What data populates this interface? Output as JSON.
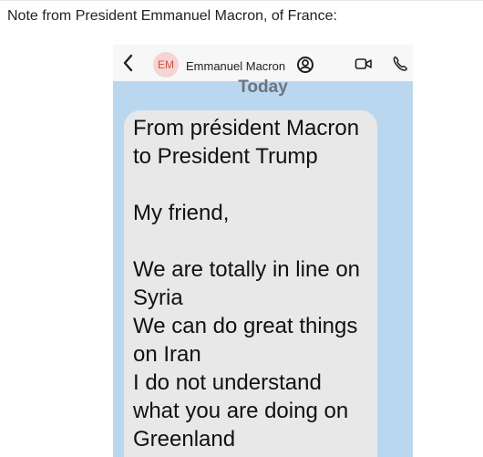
{
  "post": {
    "caption": "Note from President Emmanuel Macron, of France:"
  },
  "chat_header": {
    "back_icon": "chevron-left-icon",
    "avatar_initials": "EM",
    "contact_name": "Emmanuel Macron",
    "contact_icon": "person-circle-icon",
    "video_icon": "video-camera-icon",
    "call_icon": "phone-icon"
  },
  "conversation": {
    "date_label": "Today",
    "message_lines": [
      "From président Macron",
      "to President Trump",
      "",
      "My friend,",
      "",
      "We are totally in line on",
      "Syria",
      "We can do great things",
      "on Iran",
      "I do not understand",
      "what you are doing on",
      "Greenland"
    ]
  },
  "colors": {
    "chat_background": "#b9d8ef",
    "header_background": "#f7f7f8",
    "bubble_background": "#e8e8e9",
    "avatar_background": "#f3d6d3",
    "avatar_text": "#d94b3f",
    "date_text": "#6e7380"
  }
}
